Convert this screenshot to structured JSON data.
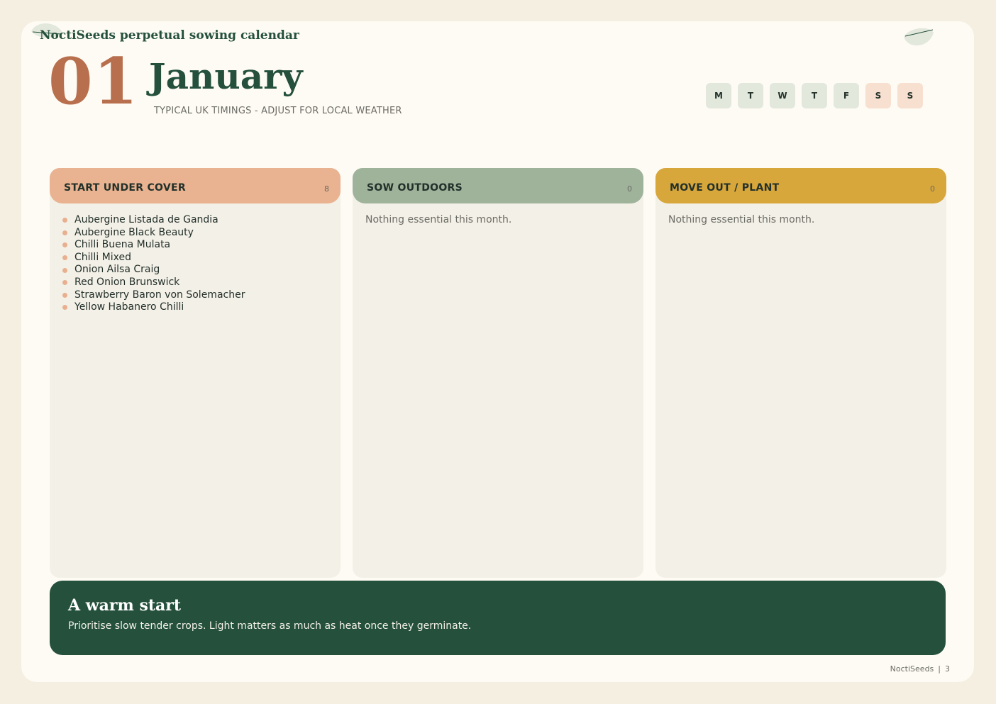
{
  "brand": "NoctiSeeds perpetual sowing calendar",
  "month": {
    "number": "01",
    "name": "January",
    "subtitle": "TYPICAL UK TIMINGS - ADJUST FOR LOCAL WEATHER"
  },
  "weekdays": [
    "M",
    "T",
    "W",
    "T",
    "F",
    "S",
    "S"
  ],
  "columns": [
    {
      "title": "START UNDER COVER",
      "count": "8",
      "color": "#e9b391",
      "items": [
        "Aubergine Listada de Gandia",
        "Aubergine Black Beauty",
        "Chilli Buena Mulata",
        "Chilli Mixed",
        "Onion Ailsa Craig",
        "Red Onion Brunswick",
        "Strawberry Baron von Solemacher",
        "Yellow Habanero Chilli"
      ],
      "empty_text": ""
    },
    {
      "title": "SOW OUTDOORS",
      "count": "0",
      "color": "#9fb39b",
      "items": [],
      "empty_text": "Nothing essential this month."
    },
    {
      "title": "MOVE OUT / PLANT",
      "count": "0",
      "color": "#d8a73b",
      "items": [],
      "empty_text": "Nothing essential this month."
    }
  ],
  "tip": {
    "title": "A warm start",
    "body": "Prioritise slow tender crops. Light matters as much as heat once they germinate."
  },
  "footer": {
    "brand": "NoctiSeeds",
    "separator": "|",
    "page": "3"
  },
  "colors": {
    "primary_green": "#24503c",
    "accent_terracotta": "#b86f4e",
    "page_bg": "#fefbf4"
  }
}
